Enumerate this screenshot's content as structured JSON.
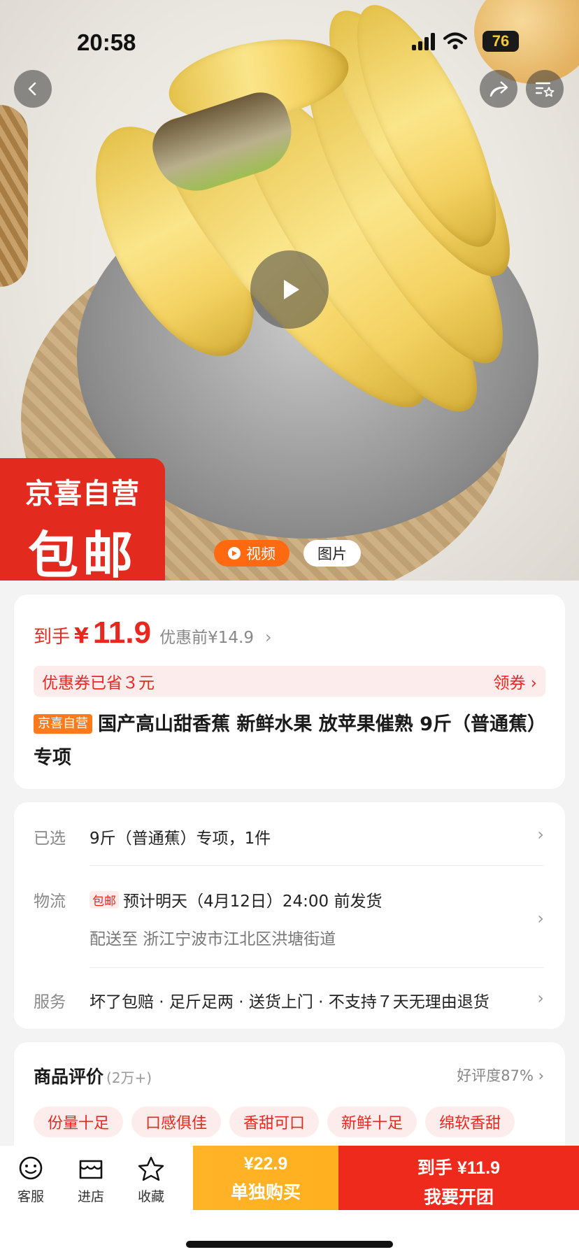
{
  "status_bar": {
    "time": "20:58",
    "battery": "76"
  },
  "hero": {
    "promo_line1": "京喜自营",
    "promo_line2": "包邮",
    "tab_video": "视频",
    "tab_image": "图片"
  },
  "price": {
    "label": "到手",
    "currency": "¥",
    "value": "11.9",
    "original": "优惠前¥14.9",
    "coupon_text": "优惠券已省３元",
    "coupon_action": "领券"
  },
  "product": {
    "tag": "京喜自营",
    "title": "国产高山甜香蕉  新鲜水果 放苹果催熟 9斤（普通蕉）专项"
  },
  "info": {
    "selected_label": "已选",
    "selected_value": "9斤（普通蕉）专项，1件",
    "logistics_label": "物流",
    "logistics_badge": "包邮",
    "logistics_value": "预计明天（4月12日）24:00 前发货",
    "address": "配送至 浙江宁波市江北区洪塘街道",
    "service_label": "服务",
    "service_value": "坏了包赔 · 足斤足两 · 送货上门 · 不支持７天无理由退货"
  },
  "reviews": {
    "title": "商品评价",
    "count": "(2万+)",
    "rate": "好评度87%",
    "chips": [
      "份量十足",
      "口感俱佳",
      "香甜可口",
      "新鲜十足",
      "绵软香甜"
    ]
  },
  "bottom_bar": {
    "service": "客服",
    "store": "进店",
    "favorite": "收藏",
    "solo_price": "¥22.9",
    "solo_label": "单独购买",
    "group_price": "到手 ¥11.9",
    "group_label": "我要开团"
  },
  "colors": {
    "accent_red": "#e8281e",
    "accent_orange": "#ffb020",
    "group_red": "#ee2a1d"
  },
  "icons": [
    "back-icon",
    "share-icon",
    "favorites-list-icon",
    "play-icon",
    "chat-icon",
    "store-icon",
    "star-icon"
  ]
}
